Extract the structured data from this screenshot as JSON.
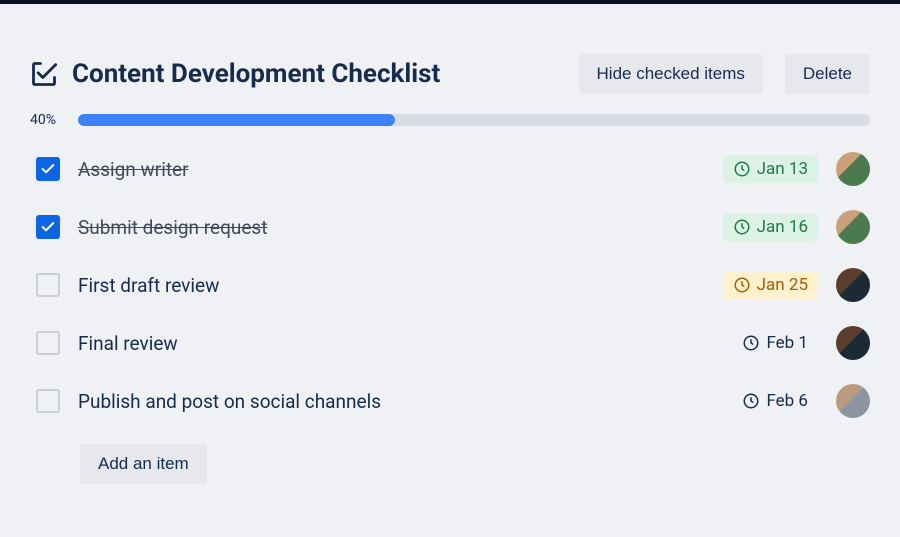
{
  "checklist": {
    "title": "Content Development Checklist",
    "progress_pct": "40%",
    "progress_value": 40,
    "actions": {
      "hide_checked": "Hide checked items",
      "delete": "Delete"
    },
    "add_item_label": "Add an item",
    "items": [
      {
        "label": "Assign writer",
        "checked": true,
        "due": "Jan 13",
        "due_status": "success",
        "avatar": "avA"
      },
      {
        "label": "Submit design request",
        "checked": true,
        "due": "Jan 16",
        "due_status": "success",
        "avatar": "avA"
      },
      {
        "label": "First draft review",
        "checked": false,
        "due": "Jan 25",
        "due_status": "warning",
        "avatar": "avB"
      },
      {
        "label": "Final review",
        "checked": false,
        "due": "Feb 1",
        "due_status": "normal",
        "avatar": "avB"
      },
      {
        "label": "Publish and post on social channels",
        "checked": false,
        "due": "Feb 6",
        "due_status": "normal",
        "avatar": "avC"
      }
    ]
  },
  "colors": {
    "accent": "#0c66e4",
    "progress_fill": "#3c82f6",
    "success_bg": "#dcf2e4",
    "warning_bg": "#fdf1ce",
    "text": "#172b4d"
  }
}
